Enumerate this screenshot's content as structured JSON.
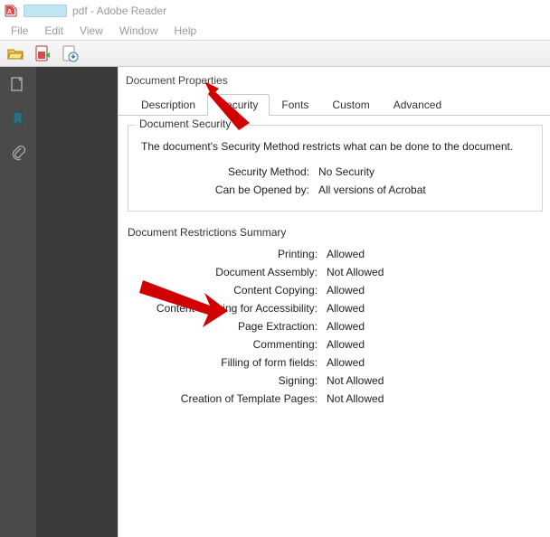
{
  "titlebar": {
    "window_title": "pdf - Adobe Reader"
  },
  "menubar": {
    "items": [
      "File",
      "Edit",
      "View",
      "Window",
      "Help"
    ]
  },
  "dialog": {
    "title": "Document Properties",
    "tabs": [
      "Description",
      "Security",
      "Fonts",
      "Custom",
      "Advanced"
    ],
    "active_tab": "Security",
    "security": {
      "legend": "Document Security",
      "description": "The document's Security Method restricts what can be done to the document.",
      "method_label": "Security Method:",
      "method_value": "No Security",
      "opened_label": "Can be Opened by:",
      "opened_value": "All versions of Acrobat"
    },
    "restrictions": {
      "title": "Document Restrictions Summary",
      "rows": [
        {
          "label": "Printing:",
          "value": "Allowed"
        },
        {
          "label": "Document Assembly:",
          "value": "Not Allowed"
        },
        {
          "label": "Content Copying:",
          "value": "Allowed"
        },
        {
          "label": "Content Copying for Accessibility:",
          "value": "Allowed"
        },
        {
          "label": "Page Extraction:",
          "value": "Allowed"
        },
        {
          "label": "Commenting:",
          "value": "Allowed"
        },
        {
          "label": "Filling of form fields:",
          "value": "Allowed"
        },
        {
          "label": "Signing:",
          "value": "Not Allowed"
        },
        {
          "label": "Creation of Template Pages:",
          "value": "Not Allowed"
        }
      ]
    }
  }
}
